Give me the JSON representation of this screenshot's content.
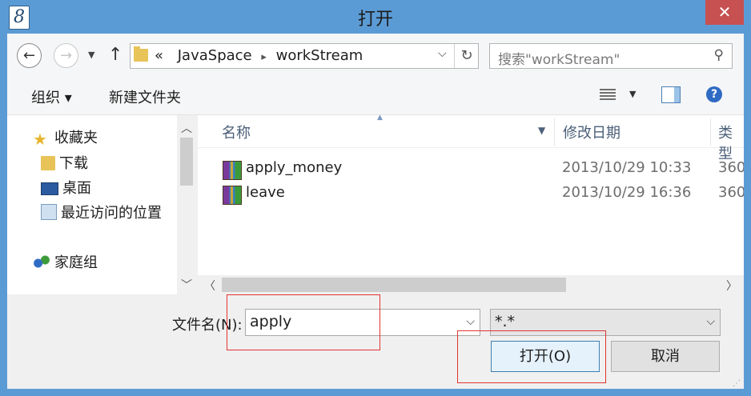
{
  "window": {
    "title": "打开",
    "app_icon_glyph": "8"
  },
  "nav": {
    "back_glyph": "←",
    "forward_glyph": "→",
    "up_glyph": "↑",
    "address": {
      "prefix": "«",
      "segments": [
        "JavaSpace",
        "workStream"
      ],
      "separator": "▸"
    },
    "search_placeholder": "搜索\"workStream\""
  },
  "toolbar": {
    "organize": "组织 ▾",
    "new_folder": "新建文件夹",
    "help": "?"
  },
  "sidebar": {
    "favorites": "收藏夹",
    "items": [
      "下载",
      "桌面",
      "最近访问的位置"
    ],
    "homegroup": "家庭组"
  },
  "list": {
    "columns": {
      "name": "名称",
      "date": "修改日期",
      "type": "类型"
    },
    "rows": [
      {
        "name": "apply_money",
        "date": "2013/10/29 10:33",
        "type": "360"
      },
      {
        "name": "leave",
        "date": "2013/10/29 16:36",
        "type": "360"
      }
    ]
  },
  "footer": {
    "filename_label": "文件名(N):",
    "filename_value": "apply",
    "filetype_value": "*.*",
    "open_button": "打开(O)",
    "cancel_button": "取消"
  },
  "colors": {
    "titlebar": "#5b9bd5",
    "close": "#c75050",
    "highlight_box": "#e0342f"
  }
}
